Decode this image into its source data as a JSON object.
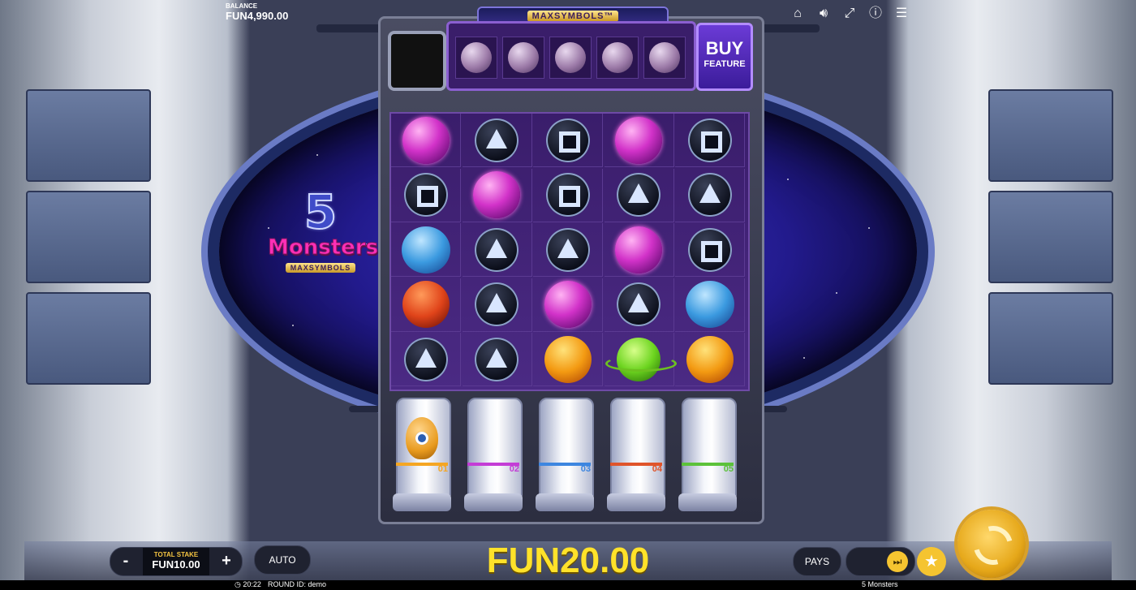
{
  "header": {
    "balance_label": "BALANCE",
    "balance_value": "FUN4,990.00",
    "banner": "MAXSYMBOLS™",
    "icons": [
      "home-icon",
      "volume-icon",
      "fullscreen-icon",
      "info-icon",
      "menu-icon"
    ]
  },
  "logo": {
    "number": "5",
    "title": "Monsters",
    "subtitle": "MAXSYMBOLS"
  },
  "buy_feature": {
    "line1": "BUY",
    "line2": "FEATURE"
  },
  "preview_symbols": [
    "pale-orb",
    "pale-orb",
    "pale-orb",
    "pale-orb",
    "pale-ringed-orb"
  ],
  "grid": [
    [
      "pink",
      "tri",
      "sq",
      "pink",
      "sq"
    ],
    [
      "sq",
      "pink",
      "sq",
      "tri",
      "tri"
    ],
    [
      "blue",
      "tri",
      "tri",
      "pink",
      "sq"
    ],
    [
      "red",
      "tri",
      "pink",
      "tri",
      "blue"
    ],
    [
      "tri",
      "tri",
      "orange",
      "green",
      "orange"
    ]
  ],
  "tubes": [
    {
      "label": "01",
      "color": "#f5a623",
      "has_monster": true
    },
    {
      "label": "02",
      "color": "#c43dd6",
      "has_monster": false
    },
    {
      "label": "03",
      "color": "#3d86e0",
      "has_monster": false
    },
    {
      "label": "04",
      "color": "#e0542a",
      "has_monster": false
    },
    {
      "label": "05",
      "color": "#5cc23a",
      "has_monster": false
    }
  ],
  "controls": {
    "minus": "-",
    "plus": "+",
    "stake_label": "TOTAL STAKE",
    "stake_value": "FUN10.00",
    "auto": "AUTO",
    "win_value": "FUN20.00",
    "pays": "PAYS",
    "speed_icon": "fast-forward-icon",
    "favorite_icon": "star-icon",
    "spin_icon": "spin-icon"
  },
  "footer": {
    "clock": "◷ 20:22",
    "round": "ROUND ID:  demo",
    "game_name": "5 Monsters"
  }
}
